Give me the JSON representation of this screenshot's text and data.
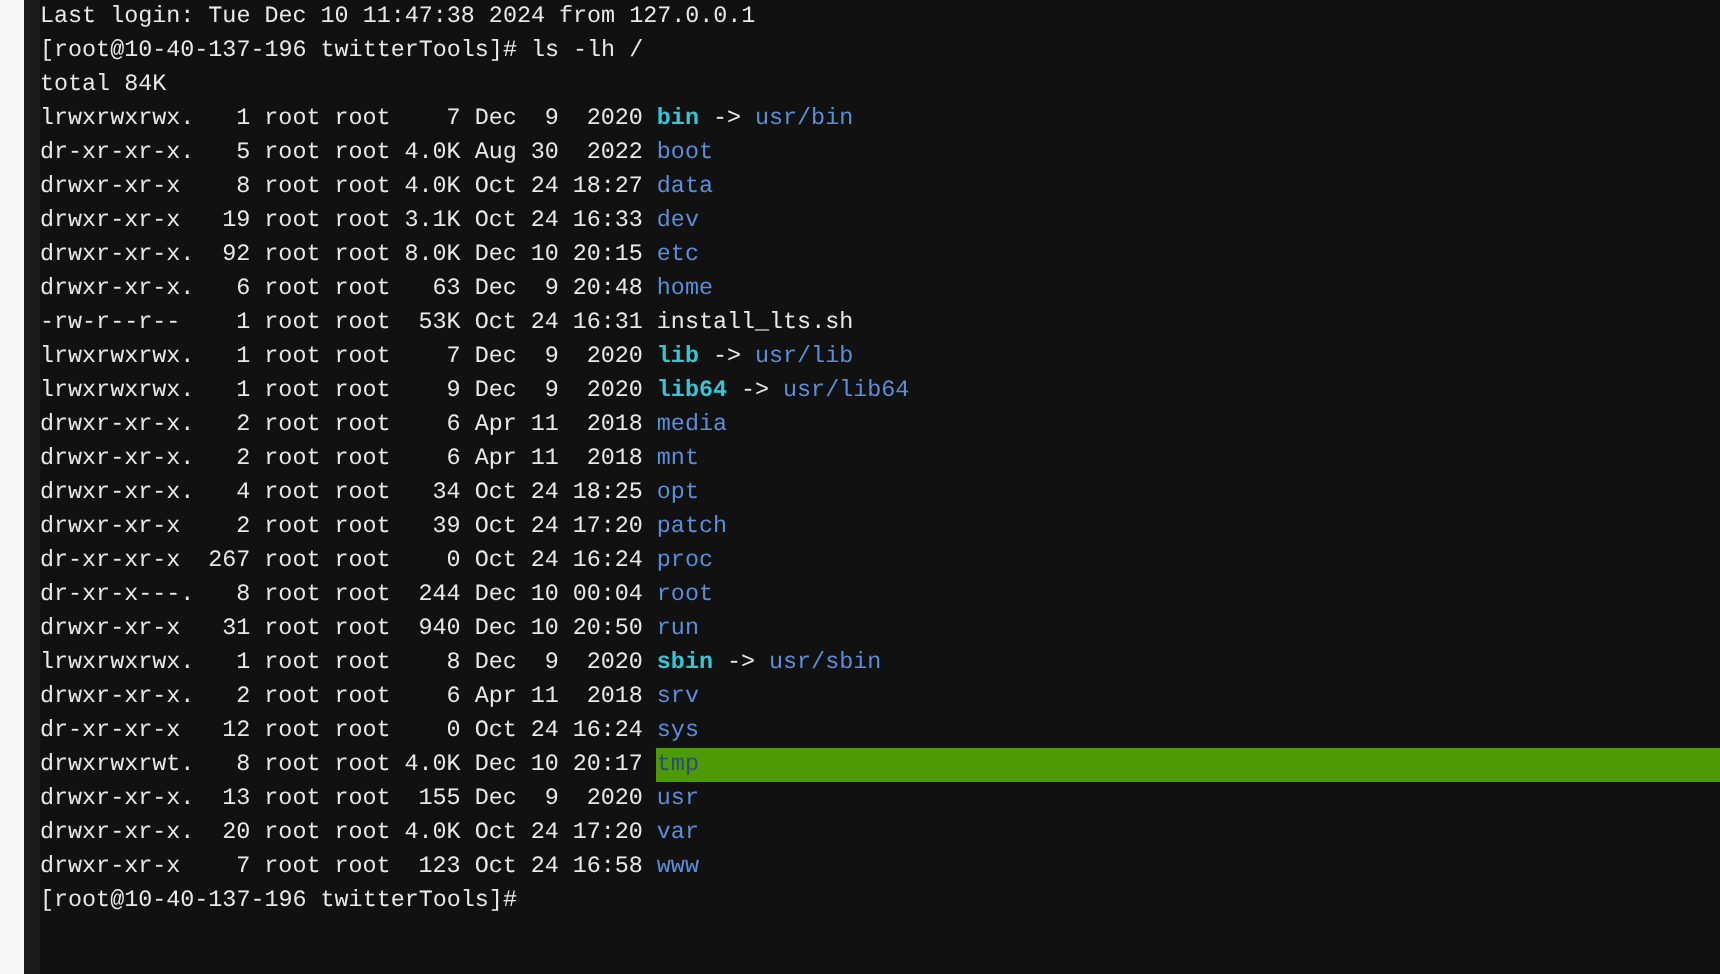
{
  "terminal": {
    "login_message": "Last login: Tue Dec 10 11:47:38 2024 from 127.0.0.1",
    "command": "[root@10-40-137-196 twitterTools]# ls -lh /",
    "total": "total 84K",
    "entries": [
      {
        "kind": "link",
        "mode": "lrwxrwxrwx.",
        "links": "1",
        "owner": "root",
        "group": "root",
        "size": "7",
        "month": "Dec",
        "day": "9",
        "time": "2020",
        "name": "bin",
        "arrow": "->",
        "target": "usr/bin"
      },
      {
        "kind": "dir",
        "mode": "dr-xr-xr-x.",
        "links": "5",
        "owner": "root",
        "group": "root",
        "size": "4.0K",
        "month": "Aug",
        "day": "30",
        "time": "2022",
        "name": "boot"
      },
      {
        "kind": "dir",
        "mode": "drwxr-xr-x",
        "links": "8",
        "owner": "root",
        "group": "root",
        "size": "4.0K",
        "month": "Oct",
        "day": "24",
        "time": "18:27",
        "name": "data"
      },
      {
        "kind": "dir",
        "mode": "drwxr-xr-x",
        "links": "19",
        "owner": "root",
        "group": "root",
        "size": "3.1K",
        "month": "Oct",
        "day": "24",
        "time": "16:33",
        "name": "dev"
      },
      {
        "kind": "dir",
        "mode": "drwxr-xr-x.",
        "links": "92",
        "owner": "root",
        "group": "root",
        "size": "8.0K",
        "month": "Dec",
        "day": "10",
        "time": "20:15",
        "name": "etc"
      },
      {
        "kind": "dir",
        "mode": "drwxr-xr-x.",
        "links": "6",
        "owner": "root",
        "group": "root",
        "size": "63",
        "month": "Dec",
        "day": "9",
        "time": "20:48",
        "name": "home"
      },
      {
        "kind": "file",
        "mode": "-rw-r--r--",
        "links": "1",
        "owner": "root",
        "group": "root",
        "size": "53K",
        "month": "Oct",
        "day": "24",
        "time": "16:31",
        "name": "install_lts.sh"
      },
      {
        "kind": "link",
        "mode": "lrwxrwxrwx.",
        "links": "1",
        "owner": "root",
        "group": "root",
        "size": "7",
        "month": "Dec",
        "day": "9",
        "time": "2020",
        "name": "lib",
        "arrow": "->",
        "target": "usr/lib"
      },
      {
        "kind": "link",
        "mode": "lrwxrwxrwx.",
        "links": "1",
        "owner": "root",
        "group": "root",
        "size": "9",
        "month": "Dec",
        "day": "9",
        "time": "2020",
        "name": "lib64",
        "arrow": "->",
        "target": "usr/lib64"
      },
      {
        "kind": "dir",
        "mode": "drwxr-xr-x.",
        "links": "2",
        "owner": "root",
        "group": "root",
        "size": "6",
        "month": "Apr",
        "day": "11",
        "time": "2018",
        "name": "media"
      },
      {
        "kind": "dir",
        "mode": "drwxr-xr-x.",
        "links": "2",
        "owner": "root",
        "group": "root",
        "size": "6",
        "month": "Apr",
        "day": "11",
        "time": "2018",
        "name": "mnt"
      },
      {
        "kind": "dir",
        "mode": "drwxr-xr-x.",
        "links": "4",
        "owner": "root",
        "group": "root",
        "size": "34",
        "month": "Oct",
        "day": "24",
        "time": "18:25",
        "name": "opt"
      },
      {
        "kind": "dir",
        "mode": "drwxr-xr-x",
        "links": "2",
        "owner": "root",
        "group": "root",
        "size": "39",
        "month": "Oct",
        "day": "24",
        "time": "17:20",
        "name": "patch"
      },
      {
        "kind": "dir",
        "mode": "dr-xr-xr-x",
        "links": "267",
        "owner": "root",
        "group": "root",
        "size": "0",
        "month": "Oct",
        "day": "24",
        "time": "16:24",
        "name": "proc"
      },
      {
        "kind": "dir",
        "mode": "dr-xr-x---.",
        "links": "8",
        "owner": "root",
        "group": "root",
        "size": "244",
        "month": "Dec",
        "day": "10",
        "time": "00:04",
        "name": "root"
      },
      {
        "kind": "dir",
        "mode": "drwxr-xr-x",
        "links": "31",
        "owner": "root",
        "group": "root",
        "size": "940",
        "month": "Dec",
        "day": "10",
        "time": "20:50",
        "name": "run"
      },
      {
        "kind": "link",
        "mode": "lrwxrwxrwx.",
        "links": "1",
        "owner": "root",
        "group": "root",
        "size": "8",
        "month": "Dec",
        "day": "9",
        "time": "2020",
        "name": "sbin",
        "arrow": "->",
        "target": "usr/sbin"
      },
      {
        "kind": "dir",
        "mode": "drwxr-xr-x.",
        "links": "2",
        "owner": "root",
        "group": "root",
        "size": "6",
        "month": "Apr",
        "day": "11",
        "time": "2018",
        "name": "srv"
      },
      {
        "kind": "dir",
        "mode": "dr-xr-xr-x",
        "links": "12",
        "owner": "root",
        "group": "root",
        "size": "0",
        "month": "Oct",
        "day": "24",
        "time": "16:24",
        "name": "sys"
      },
      {
        "kind": "sticky",
        "mode": "drwxrwxrwt.",
        "links": "8",
        "owner": "root",
        "group": "root",
        "size": "4.0K",
        "month": "Dec",
        "day": "10",
        "time": "20:17",
        "name": "tmp"
      },
      {
        "kind": "dir",
        "mode": "drwxr-xr-x.",
        "links": "13",
        "owner": "root",
        "group": "root",
        "size": "155",
        "month": "Dec",
        "day": "9",
        "time": "2020",
        "name": "usr"
      },
      {
        "kind": "dir",
        "mode": "drwxr-xr-x.",
        "links": "20",
        "owner": "root",
        "group": "root",
        "size": "4.0K",
        "month": "Oct",
        "day": "24",
        "time": "17:20",
        "name": "var"
      },
      {
        "kind": "dir",
        "mode": "drwxr-xr-x",
        "links": "7",
        "owner": "root",
        "group": "root",
        "size": "123",
        "month": "Oct",
        "day": "24",
        "time": "16:58",
        "name": "www"
      }
    ],
    "final_prompt": "[root@10-40-137-196 twitterTools]#"
  }
}
